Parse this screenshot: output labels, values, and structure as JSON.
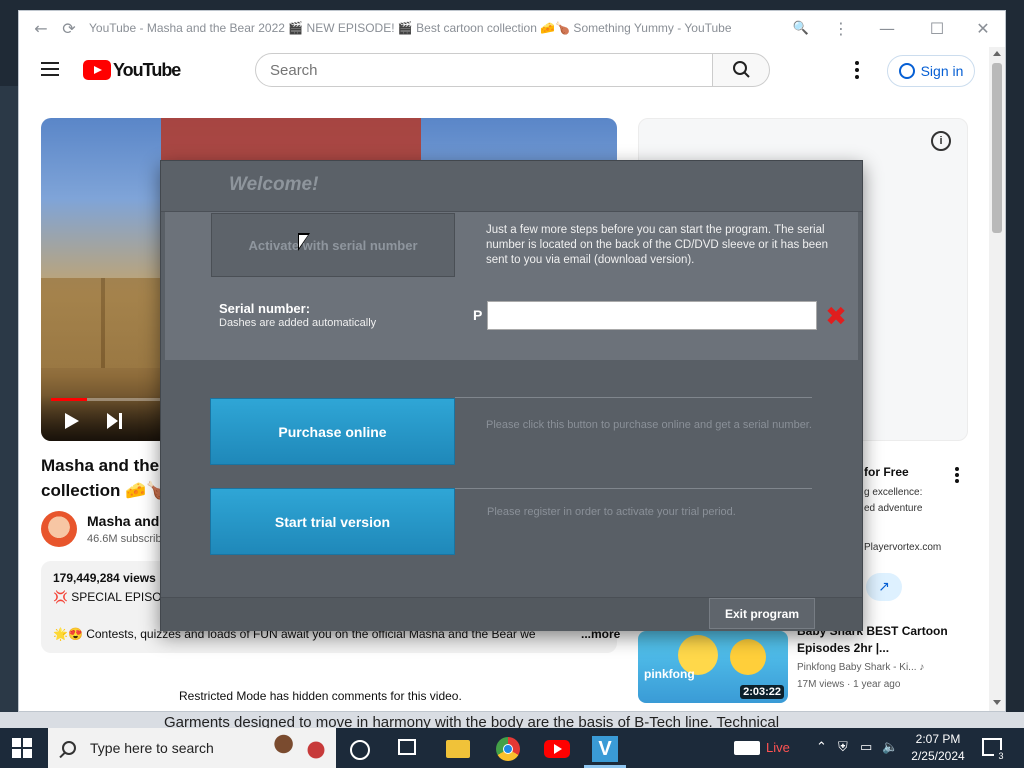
{
  "browser": {
    "title": "YouTube - Masha and the Bear 2022 🎬 NEW EPISODE! 🎬 Best cartoon collection 🧀🍗 Something Yummy - YouTube",
    "controls": {
      "minimize": "—",
      "maximize": "☐",
      "close": "✕"
    }
  },
  "youtube": {
    "logo_text": "YouTube",
    "search_placeholder": "Search",
    "signin_label": "Sign in",
    "video": {
      "title": "Masha and the collection 🧀🍗",
      "channel": "Masha and",
      "subscribers": "46.6M subscrib",
      "views": "179,449,284 views",
      "desc_line2": "💢 SPECIAL EPISO",
      "desc_line3": "🌟😍 Contests, quizzes and loads of FUN await you on the official Masha and the Bear we",
      "more": "...more",
      "restricted": "Restricted Mode has hidden comments for this video."
    },
    "ad": {
      "info": "i",
      "title": "for Free",
      "line1": "g excellence:",
      "line2": "ed adventure",
      "url": "Playervortex.com"
    },
    "related": {
      "title": "Baby Shark BEST Cartoon Episodes 2hr |...",
      "channel": "Pinkfong Baby Shark - Ki... ♪",
      "meta": "17M views · 1 year ago",
      "duration": "2:03:22",
      "brand": "pinkfong"
    }
  },
  "dialog": {
    "welcome": "Welcome!",
    "activate_label": "Activate with serial number",
    "info": "Just a few more steps before you can start the program. The serial number is located on the back of the CD/DVD sleeve or it has been sent to you via email (download version).",
    "serial_label": "Serial number:",
    "serial_hint": "Dashes are added automatically",
    "serial_prefix": "P",
    "serial_value": "",
    "clear_glyph": "✖",
    "purchase_label": "Purchase online",
    "purchase_desc": "Please click this button to purchase online and get a serial number.",
    "trial_label": "Start trial version",
    "trial_desc": "Please register in order to activate your trial period.",
    "exit_label": "Exit program"
  },
  "desktop": {
    "background_text": "Garments designed to move in harmony with the body are the basis of B-Tech line. Technical"
  },
  "taskbar": {
    "search_text": "Type here to search",
    "live": "Live",
    "time": "2:07 PM",
    "date": "2/25/2024",
    "notifications": "3"
  },
  "colors": {
    "accent_blue": "#2fa6d6",
    "youtube_red": "#ff0000",
    "dialog_bg": "#595f66",
    "clear_red": "#e01e1e"
  }
}
